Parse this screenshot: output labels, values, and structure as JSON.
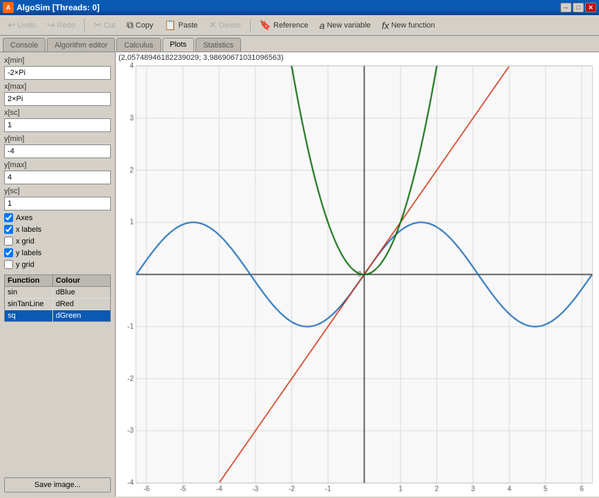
{
  "window": {
    "title": "AlgoSim [Threads: 0]",
    "logo_text": "A"
  },
  "toolbar": {
    "undo_label": "Undo",
    "redo_label": "Redo",
    "cut_label": "Cut",
    "copy_label": "Copy",
    "paste_label": "Paste",
    "delete_label": "Delete",
    "reference_label": "Reference",
    "new_variable_label": "New variable",
    "new_function_label": "New function"
  },
  "tabs": [
    {
      "label": "Console"
    },
    {
      "label": "Algorithm editor"
    },
    {
      "label": "Calculus"
    },
    {
      "label": "Plots",
      "active": true
    },
    {
      "label": "Statistics"
    }
  ],
  "left_panel": {
    "xmin_label": "x[min]",
    "xmin_value": "-2×Pi",
    "xmax_label": "x[max]",
    "xmax_value": "2×Pi",
    "xsc_label": "x[sc]",
    "xsc_value": "1",
    "ymin_label": "y[min]",
    "ymin_value": "-4",
    "ymax_label": "y[max]",
    "ymax_value": "4",
    "ysc_label": "y[sc]",
    "ysc_value": "1",
    "checkboxes": {
      "axes": {
        "label": "Axes",
        "checked": true
      },
      "x_labels": {
        "label": "x labels",
        "checked": true
      },
      "x_grid": {
        "label": "x grid",
        "checked": false
      },
      "y_labels": {
        "label": "y labels",
        "checked": true
      },
      "y_grid": {
        "label": "y grid",
        "checked": false
      }
    },
    "table": {
      "col1_header": "Function",
      "col2_header": "Colour",
      "rows": [
        {
          "fn": "sin",
          "color": "dBlue",
          "selected": false
        },
        {
          "fn": "sinTanLine",
          "color": "dRed",
          "selected": false
        },
        {
          "fn": "sq",
          "color": "dGreen",
          "selected": true
        }
      ]
    },
    "save_button": "Save image..."
  },
  "plot": {
    "coords_text": "(2,05748946182239029; 3,98690671031096563)"
  }
}
